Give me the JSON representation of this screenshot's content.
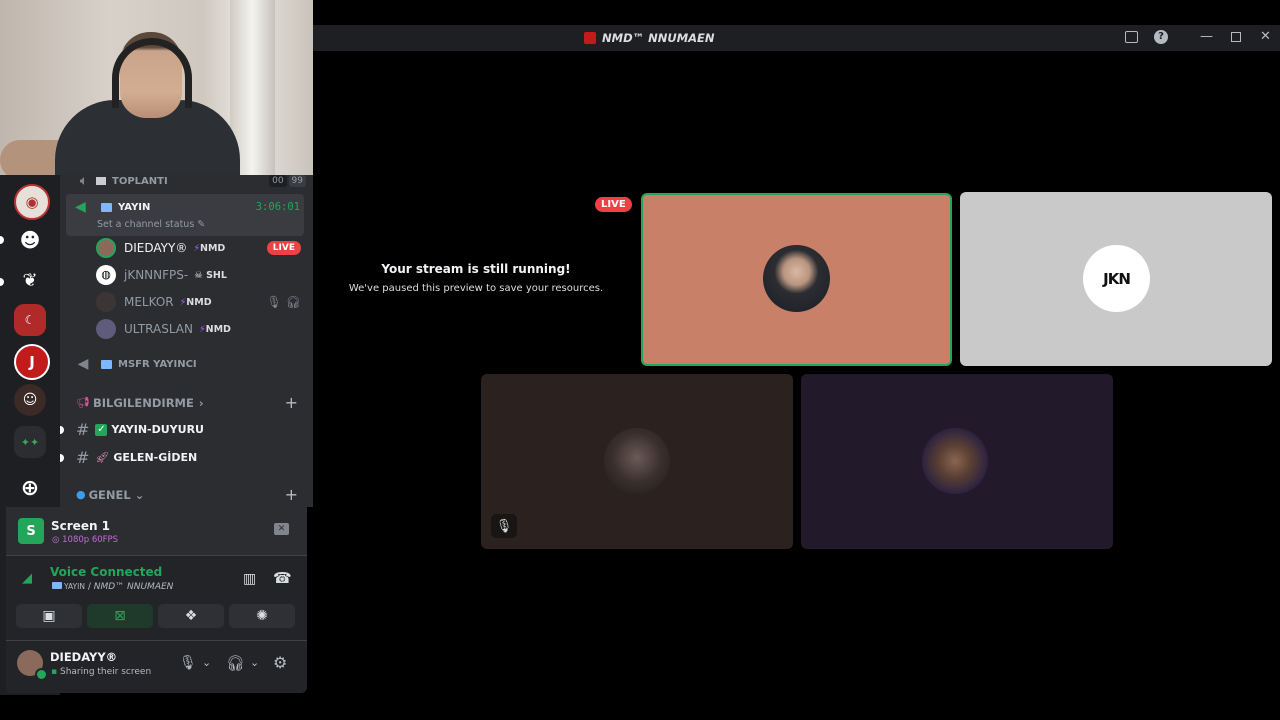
{
  "window": {
    "title": "NMD™ NNUMAEN"
  },
  "servers": [
    {
      "icon": "avatar-server-icon"
    },
    {
      "icon": "mask-server-icon"
    },
    {
      "icon": "dragon-server-icon"
    },
    {
      "icon": "flag-server-icon"
    },
    {
      "icon": "j-server-icon"
    },
    {
      "icon": "person-server-icon"
    },
    {
      "icon": "group-server-icon"
    },
    {
      "icon": "add-server-icon"
    }
  ],
  "channels": {
    "toplanti": {
      "name": "TOPLANTI",
      "counter_a": "00",
      "counter_b": "99"
    },
    "yayin": {
      "name": "YAYIN",
      "timer": "3:06:01",
      "status_placeholder": "Set a channel status"
    },
    "members": [
      {
        "name": "DIEDAYY®",
        "tag": "NMD",
        "live": "LIVE"
      },
      {
        "name": "jKNNNFPS-",
        "tag": "SHL"
      },
      {
        "name": "MELKOR",
        "tag": "NMD"
      },
      {
        "name": "ULTRASLAN",
        "tag": "NMD"
      }
    ],
    "msfr": {
      "name": "MSFR YAYINCI"
    },
    "bilgilendirme": {
      "name": "BILGILENDIRME"
    },
    "yayin_duyuru": {
      "name": "YAYIN-DUYURU"
    },
    "gelen_giden": {
      "name": "GELEN-GİDEN"
    },
    "genel": {
      "name": "GENEL"
    }
  },
  "screen_panel": {
    "title": "Screen 1",
    "quality": "1080p 60FPS"
  },
  "voice": {
    "status": "Voice Connected",
    "channel_prefix": "YAYIN",
    "channel_server": "NMD™ NNUMAEN"
  },
  "user": {
    "name": "DIEDAYY®",
    "status": "Sharing their screen"
  },
  "stage": {
    "live": "LIVE",
    "paused_title": "Your stream is still running!",
    "paused_sub": "We've paused this preview to save your resources.",
    "logo_text": "JKN"
  },
  "colors": {
    "accent_green": "#23a55a",
    "live_red": "#ed4245",
    "nitro_purple": "#a259ff",
    "tile_orange": "#c98068",
    "tile_light": "#c9c9c9"
  }
}
